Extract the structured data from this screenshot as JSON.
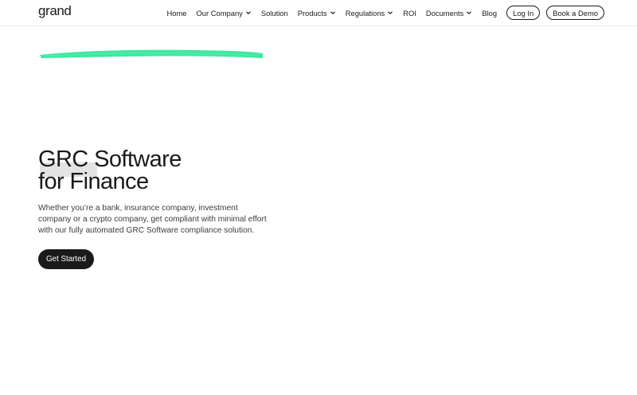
{
  "header": {
    "logo": "grand",
    "nav": [
      {
        "label": "Home",
        "dropdown": false
      },
      {
        "label": "Our Company",
        "dropdown": true
      },
      {
        "label": "Solution",
        "dropdown": false
      },
      {
        "label": "Products",
        "dropdown": true
      },
      {
        "label": "Regulations",
        "dropdown": true
      },
      {
        "label": "ROI",
        "dropdown": false
      },
      {
        "label": "Documents",
        "dropdown": true
      },
      {
        "label": "Blog",
        "dropdown": false
      }
    ],
    "login_label": "Log In",
    "demo_label": "Book a Demo"
  },
  "hero": {
    "title_line1": "GRC Software",
    "title_line2": "for Finance",
    "description": "Whether you’re a bank, insurance company, investment company or a crypto company, get compliant with minimal effort with our fully automated GRC Software compliance solution.",
    "cta_label": "Get Started"
  },
  "colors": {
    "accent_stroke": "#3ee8a0",
    "text": "#1a1a1a",
    "button_bg": "#1a1a1a"
  },
  "icons": {
    "dropdown": "chevron-down-icon",
    "decoration": "brush-stroke"
  }
}
